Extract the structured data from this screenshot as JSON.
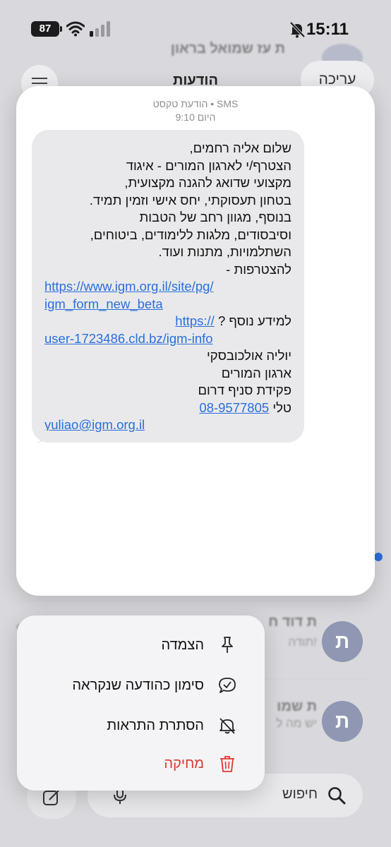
{
  "status_bar": {
    "time": "15:11",
    "battery": "87"
  },
  "header": {
    "title": "הודעות",
    "edit_label": "עריכה"
  },
  "background_list": {
    "top_name": "ת עז שמואל בראון",
    "rows": [
      {
        "name": "ת דוד ח",
        "preview": "תודה!",
        "avatar": "ת"
      },
      {
        "name": "ת שמו",
        "preview": "יש מה ל",
        "avatar": "ת"
      }
    ]
  },
  "message": {
    "header_line1": "הודעת טקסט • SMS",
    "header_line2": "היום 9:10",
    "lines": [
      "שלום אליה רחמים,",
      "הצטרף/י לארגון המורים - איגוד",
      "מקצועי שדואג להגנה מקצועית,",
      "בטחון תעסוקתי, יחס אישי וזמין תמיד.",
      "בנוסף, מגוון רחב של הטבות",
      "וסיבסודים, מלגות ללימודים, ביטוחים,",
      "השתלמויות, מתנות ועוד.",
      "להצטרפות -"
    ],
    "link1_a": "https://www.igm.org.il/site/pg/",
    "link1_b": "igm_form_new_beta",
    "more_info": "למידע נוסף ?",
    "link2_a": "https://",
    "link2_b": "user-1723486.cld.bz/igm-info",
    "sig_name": "יוליה אולכובסקי",
    "sig_org": "ארגון המורים",
    "sig_role": "פקידת סניף דרום",
    "phone_label": "טלי",
    "phone": "08-9577805",
    "email": "yuliao@igm.org.il"
  },
  "menu": {
    "pin": "הצמדה",
    "mark_read": "סימון כהודעה שנקראה",
    "hide_alerts": "הסתרת התראות",
    "delete": "מחיקה"
  },
  "search": {
    "placeholder": "חיפוש"
  },
  "colors": {
    "accent": "#2a6fdb",
    "danger": "#e0362d",
    "bubble": "#e9e9eb"
  }
}
